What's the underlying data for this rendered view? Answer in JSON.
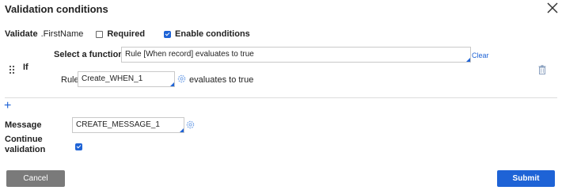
{
  "dialog": {
    "title": "Validation conditions",
    "close_icon": "close-icon"
  },
  "validate_row": {
    "label": "Validate",
    "field": ".FirstName",
    "required_label": "Required",
    "required_checked": false,
    "enable_label": "Enable conditions",
    "enable_checked": true
  },
  "condition": {
    "if_label": "If",
    "function_label": "Select a function",
    "function_value": "Rule [When record] evaluates to true",
    "clear_label": "Clear",
    "rule_label": "Rule",
    "rule_value": "Create_WHEN_1",
    "evaluates_text": "evaluates to true"
  },
  "message": {
    "label": "Message",
    "value": "CREATE_MESSAGE_1"
  },
  "continue_validation": {
    "label": "Continue validation",
    "checked": true
  },
  "buttons": {
    "cancel_label": "Cancel",
    "submit_label": "Submit"
  },
  "colors": {
    "accent": "#1e63d6",
    "cancel_bg": "#7a7a7a"
  },
  "icons": {
    "drag": "drag-handle-icon",
    "gear": "gear-icon",
    "trash": "trash-icon",
    "add": "plus-icon"
  }
}
